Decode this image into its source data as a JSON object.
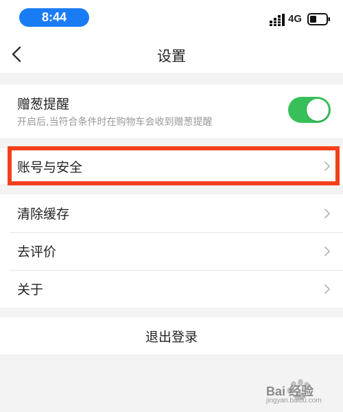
{
  "status_bar": {
    "time": "8:44",
    "network": "4G",
    "time_pill_color": "#1a7cf5",
    "icons": [
      "signal-icon",
      "battery-icon"
    ]
  },
  "nav": {
    "title": "设置",
    "back_icon": "chevron-left-icon"
  },
  "gift_reminder": {
    "title": "赠葱提醒",
    "description": "开启后,当符合条件时在购物车会收到赠葱提醒",
    "enabled": true,
    "toggle_color": "#37c05a"
  },
  "account": {
    "label": "账号与安全",
    "highlight_color": "#f2401c"
  },
  "menu": {
    "items": [
      {
        "label": "清除缓存"
      },
      {
        "label": "去评价"
      },
      {
        "label": "关于"
      }
    ]
  },
  "logout": {
    "label": "退出登录"
  },
  "watermark": {
    "brand": "Bai 经验",
    "url": "jingyan.baidu.com"
  }
}
